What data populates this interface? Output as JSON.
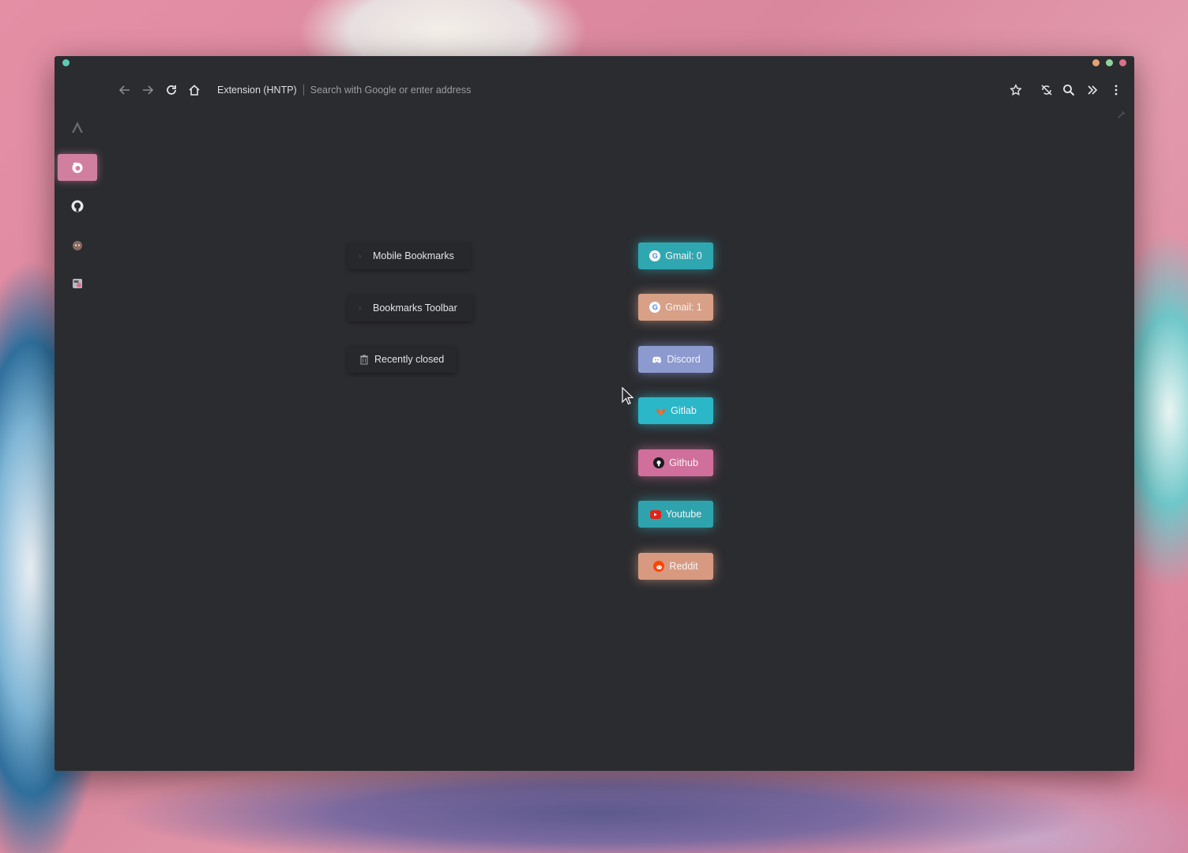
{
  "toolbar": {
    "url_identity": "Extension (HNTP)",
    "url_placeholder": "Search with Google or enter address"
  },
  "folders": [
    {
      "label": "Mobile Bookmarks",
      "icon": "chevron-right-icon"
    },
    {
      "label": "Bookmarks Toolbar",
      "icon": "chevron-right-icon"
    },
    {
      "label": "Recently closed",
      "icon": "trash-icon"
    }
  ],
  "bookmarks": [
    {
      "label": "Gmail: 0",
      "icon": "google-icon",
      "color": "#2fa7b0"
    },
    {
      "label": "Gmail: 1",
      "icon": "google-icon",
      "color": "#d7a087"
    },
    {
      "label": "Discord",
      "icon": "discord-icon",
      "color": "#8c9ad0"
    },
    {
      "label": "Gitlab",
      "icon": "gitlab-icon",
      "color": "#2bb7c8"
    },
    {
      "label": "Github",
      "icon": "github-icon",
      "color": "#d06f9b"
    },
    {
      "label": "Youtube",
      "icon": "youtube-icon",
      "color": "#2fa3ad"
    },
    {
      "label": "Reddit",
      "icon": "reddit-icon",
      "color": "#d79a80"
    }
  ],
  "colors": {
    "window_bg": "#2b2c30",
    "accent_pink": "#d0809e",
    "titlebar_dots": [
      "#e6a272",
      "#8fd39b",
      "#d9718c"
    ],
    "left_dot": "#5fc9b4"
  }
}
